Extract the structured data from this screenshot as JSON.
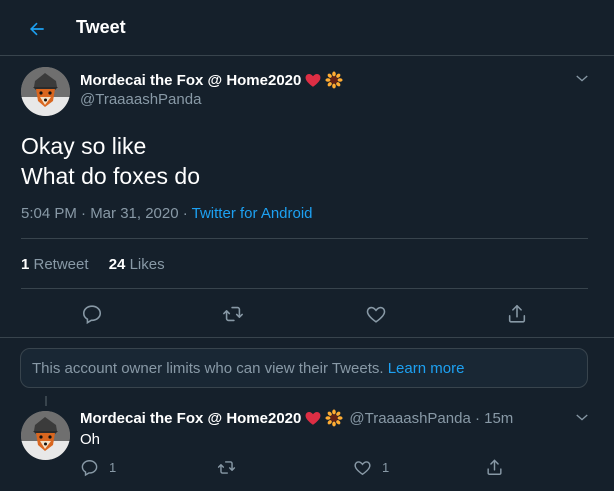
{
  "header": {
    "title": "Tweet"
  },
  "tweet": {
    "display_name": "Mordecai the Fox @ Home2020",
    "emojis": [
      "heart-emoji",
      "sunflower-emoji"
    ],
    "handle": "@TraaaashPanda",
    "text_line_1": "Okay so like",
    "text_line_2": "What do foxes do",
    "time": "5:04 PM · Mar 31, 2020 · ",
    "source": "Twitter for Android",
    "retweet_count": "1",
    "retweet_label": " Retweet",
    "like_count": "24",
    "like_label": " Likes"
  },
  "notice": {
    "text": "This account owner limits who can view their Tweets. ",
    "link": "Learn more"
  },
  "reply": {
    "display_name": "Mordecai the Fox @ Home2020",
    "handle_time": "@TraaaashPanda · 15m",
    "text": "Oh",
    "reply_count": "1",
    "like_count": "1"
  },
  "colors": {
    "background": "#15202b",
    "accent": "#1da1f2",
    "muted": "#8899a6",
    "border": "#38444d"
  }
}
